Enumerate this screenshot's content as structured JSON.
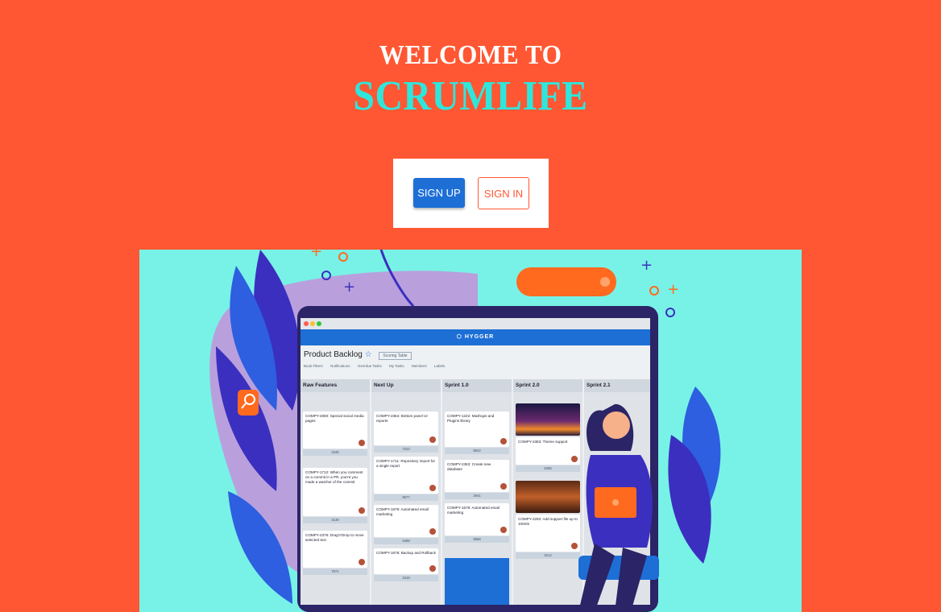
{
  "header": {
    "welcome_line": "WELCOME TO",
    "brand_line": "SCRUMLIFE"
  },
  "auth": {
    "signup_label": "SIGN UP",
    "signin_label": "SIGN IN"
  },
  "colors": {
    "background": "#ff5733",
    "brand_text": "#2fe6dc",
    "signup_button": "#1d6fd6",
    "signin_border": "#ff5733",
    "hero_background": "#78f2e6"
  },
  "hero_illustration": {
    "app_name": "HYGGER",
    "board_title": "Product Backlog",
    "board_tag": "Scoring Table",
    "tabs": [
      "Book Filters",
      "Notifications",
      "Overdue Tasks",
      "My Tasks",
      "Members",
      "Labels"
    ],
    "columns": [
      {
        "title": "Raw Features",
        "cards": [
          {
            "text": "COMPY-2050: Special social media pages",
            "sum": "2346"
          },
          {
            "text": "COMPY-1712: When you comment on a commit in a PR, you're you made a watcher of the commit",
            "sum": "3138"
          },
          {
            "text": "COMPY-2376: Drag'n'Drop to move selected text",
            "sum": "7871"
          }
        ]
      },
      {
        "title": "Next Up",
        "cards": [
          {
            "text": "COMPY-2364: Bottom panel UI reports",
            "sum": "7223"
          },
          {
            "text": "COMPY-1711: Repository import for a single report",
            "sum": "8577"
          },
          {
            "text": "COMPY-1679: Automated email marketing",
            "sum": "9498"
          },
          {
            "text": "COMPY-1678: Backup and Rollback",
            "sum": "1618"
          }
        ]
      },
      {
        "title": "Sprint 1.0",
        "cards": [
          {
            "text": "COMPY-1222: Mashups and Plugins library",
            "sum": "8842"
          },
          {
            "text": "COMPY-2363: Create new database",
            "sum": "2941"
          },
          {
            "text": "COMPY-1678: Automated email marketing",
            "sum": "8858"
          }
        ]
      },
      {
        "title": "Sprint 2.0",
        "cards": [
          {
            "text": "COMPY-2383: Theme support",
            "sum": "5455"
          },
          {
            "text": "COMPY-2292: Add support file up to 100mb",
            "sum": "3214"
          }
        ]
      },
      {
        "title": "Sprint 2.1",
        "cards": []
      }
    ]
  }
}
